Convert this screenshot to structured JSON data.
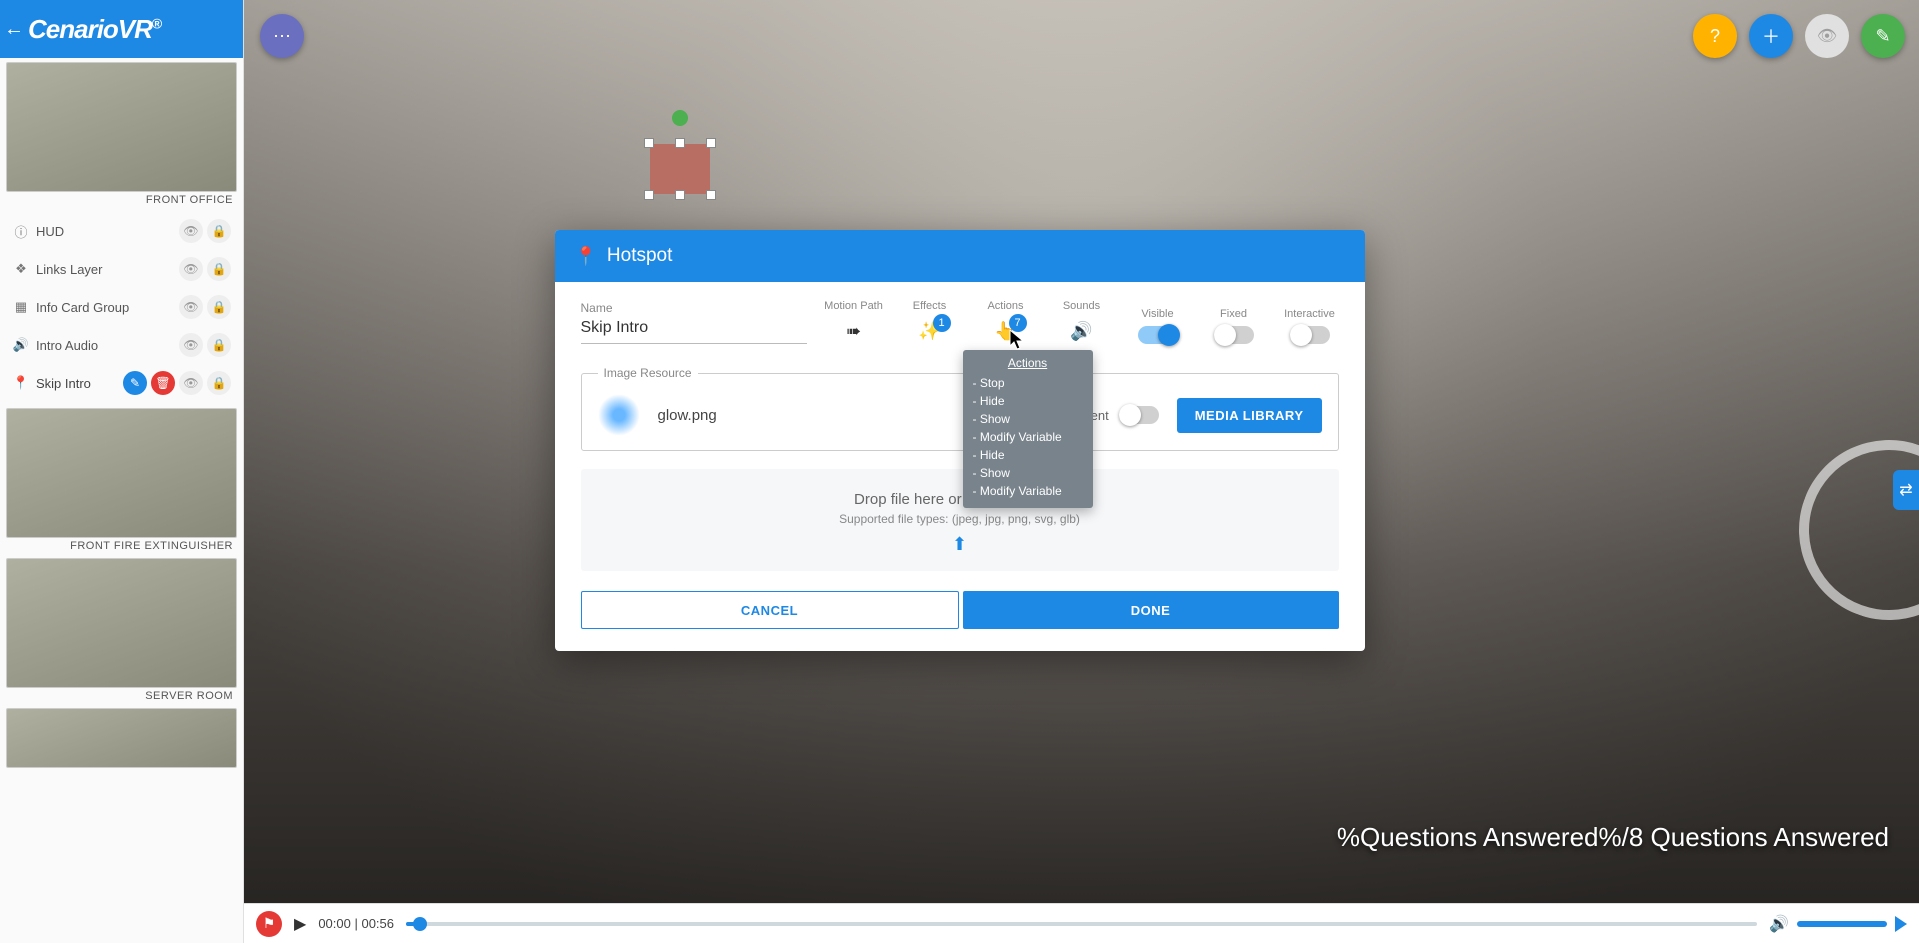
{
  "app": {
    "name": "CenarioVR"
  },
  "sidebar": {
    "scenes": [
      {
        "caption": "FRONT OFFICE"
      },
      {
        "caption": "FRONT FIRE EXTINGUISHER"
      },
      {
        "caption": "SERVER ROOM"
      }
    ],
    "layers": [
      {
        "icon": "info",
        "name": "HUD"
      },
      {
        "icon": "layers",
        "name": "Links Layer"
      },
      {
        "icon": "grid",
        "name": "Info Card Group"
      },
      {
        "icon": "audio",
        "name": "Intro Audio"
      },
      {
        "icon": "pin",
        "name": "Skip Intro",
        "selected": true
      }
    ]
  },
  "modal": {
    "title": "Hotspot",
    "name_label": "Name",
    "name_value": "Skip Intro",
    "tools": {
      "motion_path": "Motion Path",
      "effects": "Effects",
      "effects_badge": "1",
      "actions": "Actions",
      "actions_badge": "7",
      "sounds": "Sounds",
      "visible": "Visible",
      "fixed": "Fixed",
      "interactive": "Interactive"
    },
    "image_resource": {
      "legend": "Image Resource",
      "filename": "glow.png",
      "transparent_label": "Transparent",
      "media_library": "MEDIA LIBRARY"
    },
    "drop": {
      "line1": "Drop file here or click to upload.",
      "line2": "Supported file types: (jpeg, jpg, png, svg, glb)"
    },
    "buttons": {
      "cancel": "CANCEL",
      "done": "DONE"
    },
    "popover": {
      "title": "Actions",
      "items": [
        "Stop",
        "Hide",
        "Show",
        "Modify Variable",
        "Hide",
        "Show",
        "Modify Variable"
      ]
    }
  },
  "overlay_text": "%Questions Answered%/8 Questions Answered",
  "timeline": {
    "current": "00:00",
    "total": "00:56"
  }
}
